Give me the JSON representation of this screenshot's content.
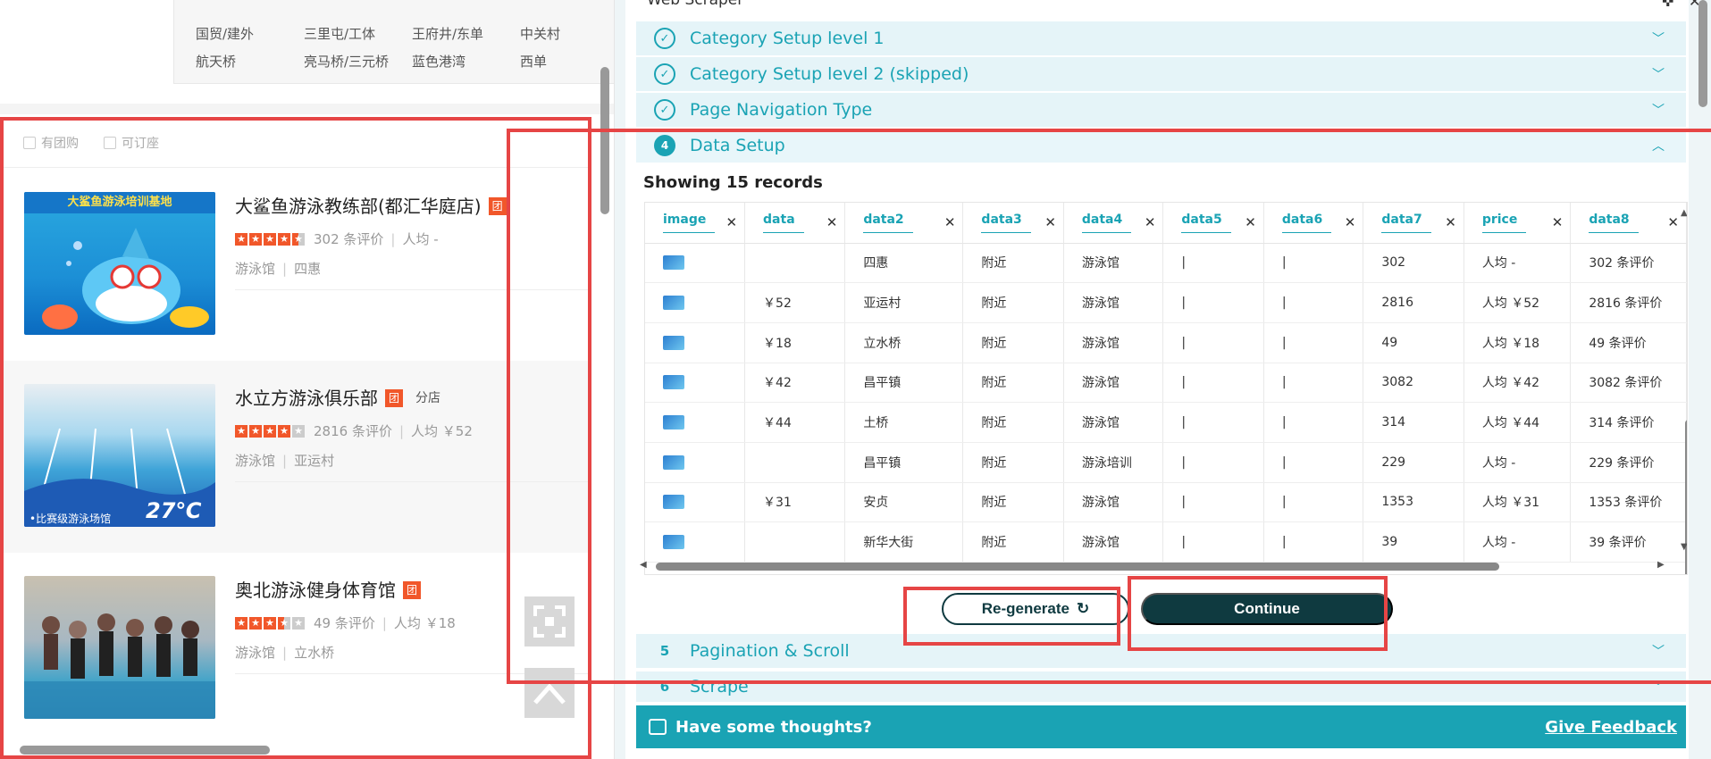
{
  "left_panel": {
    "areas": [
      [
        "国贸/建外",
        "三里屯/工体",
        "王府井/东单",
        "中关村"
      ],
      [
        "航天桥",
        "亮马桥/三元桥",
        "蓝色港湾",
        "西单"
      ]
    ],
    "filters": [
      "有团购",
      "可订座"
    ],
    "shops": [
      {
        "name": "大鲨鱼游泳教练部(都汇华庭店)",
        "tuan": "团",
        "branch": "",
        "reviews": "302 条评价",
        "avg": "人均 -",
        "category": "游泳馆",
        "area": "四惠",
        "stars": 4.5,
        "pic_text": "大鲨鱼游泳培训基地"
      },
      {
        "name": "水立方游泳俱乐部",
        "tuan": "团",
        "branch": "分店",
        "reviews": "2816 条评价",
        "avg": "人均 ￥52",
        "category": "游泳馆",
        "area": "亚运村",
        "stars": 4,
        "pic_text": "•比赛级游泳场馆",
        "pic_temp": "27℃"
      },
      {
        "name": "奥北游泳健身体育馆",
        "tuan": "团",
        "branch": "",
        "reviews": "49 条评价",
        "avg": "人均 ￥18",
        "category": "游泳馆",
        "area": "立水桥",
        "stars": 3.5,
        "pic_text": ""
      }
    ]
  },
  "scraper": {
    "title": "Web Scraper",
    "steps": [
      {
        "label": "Category Setup level 1",
        "state": "done"
      },
      {
        "label": "Category Setup level 2 (skipped)",
        "state": "done"
      },
      {
        "label": "Page Navigation Type",
        "state": "done"
      },
      {
        "label": "Data Setup",
        "state": "open",
        "num": "4"
      },
      {
        "label": "Pagination & Scroll",
        "state": "todo",
        "num": "5"
      },
      {
        "label": "Scrape",
        "state": "todo",
        "num": "6"
      }
    ],
    "records_text": "Showing 15 records",
    "columns": [
      "image",
      "data",
      "data2",
      "data3",
      "data4",
      "data5",
      "data6",
      "data7",
      "price",
      "data8"
    ],
    "rows": [
      [
        "",
        "",
        "四惠",
        "附近",
        "游泳馆",
        "|",
        "|",
        "302",
        "人均 -",
        "302 条评价"
      ],
      [
        "",
        "￥52",
        "亚运村",
        "附近",
        "游泳馆",
        "|",
        "|",
        "2816",
        "人均 ￥52",
        "2816 条评价"
      ],
      [
        "",
        "￥18",
        "立水桥",
        "附近",
        "游泳馆",
        "|",
        "|",
        "49",
        "人均 ￥18",
        "49 条评价"
      ],
      [
        "",
        "￥42",
        "昌平镇",
        "附近",
        "游泳馆",
        "|",
        "|",
        "3082",
        "人均 ￥42",
        "3082 条评价"
      ],
      [
        "",
        "￥44",
        "土桥",
        "附近",
        "游泳馆",
        "|",
        "|",
        "314",
        "人均 ￥44",
        "314 条评价"
      ],
      [
        "",
        "",
        "昌平镇",
        "附近",
        "游泳培训",
        "|",
        "|",
        "229",
        "人均 -",
        "229 条评价"
      ],
      [
        "",
        "￥31",
        "安贞",
        "附近",
        "游泳馆",
        "|",
        "|",
        "1353",
        "人均 ￥31",
        "1353 条评价"
      ],
      [
        "",
        "",
        "新华大街",
        "附近",
        "游泳馆",
        "|",
        "|",
        "39",
        "人均 -",
        "39 条评价"
      ]
    ],
    "regenerate_label": "Re-generate",
    "continue_label": "Continue",
    "feedback_prompt": "Have some thoughts?",
    "feedback_link": "Give Feedback"
  },
  "colors": {
    "accent": "#1aa3b4",
    "dark": "#0f3a40",
    "highlight": "#e64545",
    "tag": "#f1572a"
  }
}
